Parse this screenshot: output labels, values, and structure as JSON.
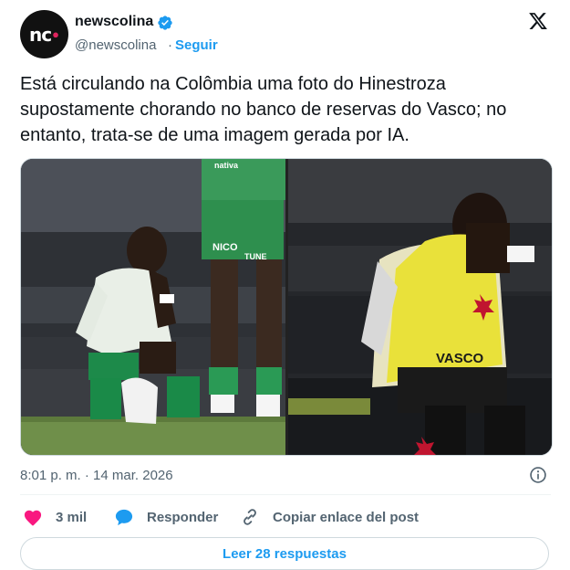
{
  "header": {
    "avatar_text": "nc",
    "display_name": "newscolina",
    "handle": "@newscolina",
    "separator": "·",
    "follow_label": "Seguir",
    "verified_icon": "verified-badge-icon",
    "platform_icon": "x-logo-icon"
  },
  "tweet": {
    "text": "Está circulando na Colômbia uma foto do Hinestroza supostamente chorando no banco de reservas do Vasco; no entanto, trata-se de uma imagem gerada por IA.",
    "timestamp": "8:01 p. m. · 14 mar. 2026"
  },
  "media": {
    "left_jersey_text": "NICO",
    "left_sponsor_text": "TUNE",
    "left_banner_text": "nativa",
    "right_bib_text": "VASCO"
  },
  "actions": {
    "likes_count": "3 mil",
    "reply_label": "Responder",
    "copy_label": "Copiar enlace del post",
    "read_more_label": "Leer 28 respuestas"
  },
  "colors": {
    "accent": "#1d9bf0",
    "like": "#f91880",
    "text_secondary": "#536471"
  }
}
